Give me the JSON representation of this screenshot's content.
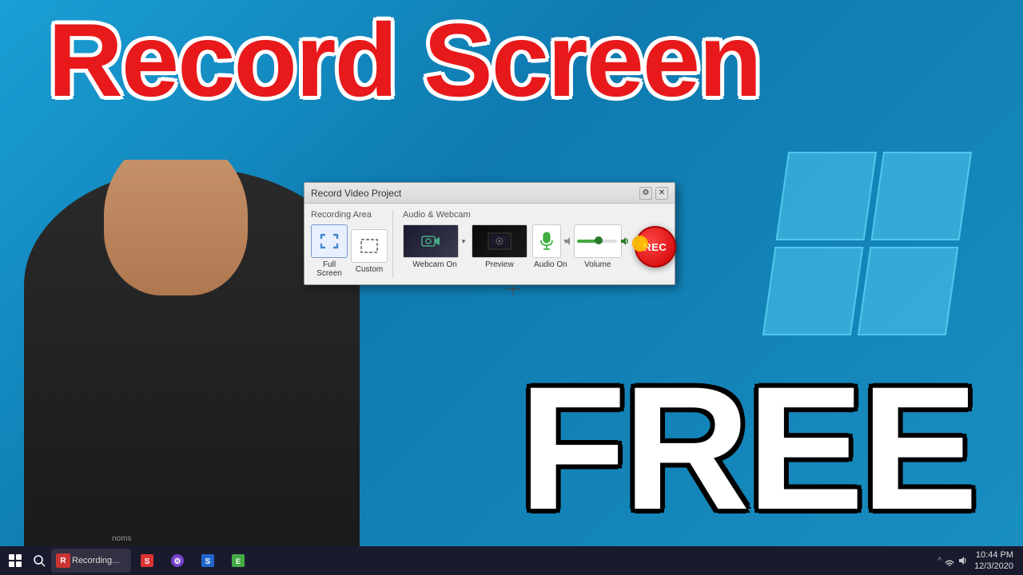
{
  "background": {
    "color": "#1a8fc1"
  },
  "title_main": "Record Screen",
  "title_free": "FREE",
  "dialog": {
    "title": "Record Video Project",
    "sections": {
      "recording_area": {
        "label": "Recording Area",
        "fullscreen_label": "Full Screen",
        "custom_label": "Custom"
      },
      "audio_webcam": {
        "label": "Audio & Webcam",
        "webcam_label": "Webcam On",
        "preview_label": "Preview",
        "audio_label": "Audio On",
        "volume_label": "Volume"
      }
    },
    "rec_button_label": "REC"
  },
  "taskbar": {
    "running_app": "Recording...",
    "time": "10:44 PM",
    "date": "12/3/2020",
    "show_hidden_label": "^"
  }
}
